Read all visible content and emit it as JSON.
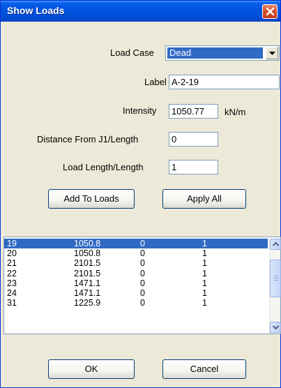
{
  "window": {
    "title": "Show Loads"
  },
  "form": {
    "load_case_label": "Load Case",
    "load_case_value": "Dead",
    "label_label": "Label",
    "label_value": "A-2-19",
    "intensity_label": "Intensity",
    "intensity_value": "1050.77",
    "intensity_unit": "kN/m",
    "distance_label": "Distance From J1/Length",
    "distance_value": "0",
    "load_length_label": "Load Length/Length",
    "load_length_value": "1"
  },
  "buttons": {
    "add_to_loads": "Add To Loads",
    "apply_all": "Apply All",
    "ok": "OK",
    "cancel": "Cancel"
  },
  "loads": [
    {
      "id": "19",
      "intensity": "1050.8",
      "distance": "0",
      "length": "1",
      "selected": true
    },
    {
      "id": "20",
      "intensity": "1050.8",
      "distance": "0",
      "length": "1"
    },
    {
      "id": "21",
      "intensity": "2101.5",
      "distance": "0",
      "length": "1"
    },
    {
      "id": "22",
      "intensity": "2101.5",
      "distance": "0",
      "length": "1"
    },
    {
      "id": "23",
      "intensity": "1471.1",
      "distance": "0",
      "length": "1"
    },
    {
      "id": "24",
      "intensity": "1471.1",
      "distance": "0",
      "length": "1"
    },
    {
      "id": "31",
      "intensity": "1225.9",
      "distance": "0",
      "length": "1"
    }
  ],
  "colors": {
    "selection": "#316ac5",
    "titlebar": "#0054e3",
    "dialog_bg": "#ece9d8"
  },
  "icons": {
    "close": "close-icon",
    "dropdown": "chevron-down-icon",
    "scroll_up": "chevron-up-icon",
    "scroll_down": "chevron-down-icon"
  }
}
